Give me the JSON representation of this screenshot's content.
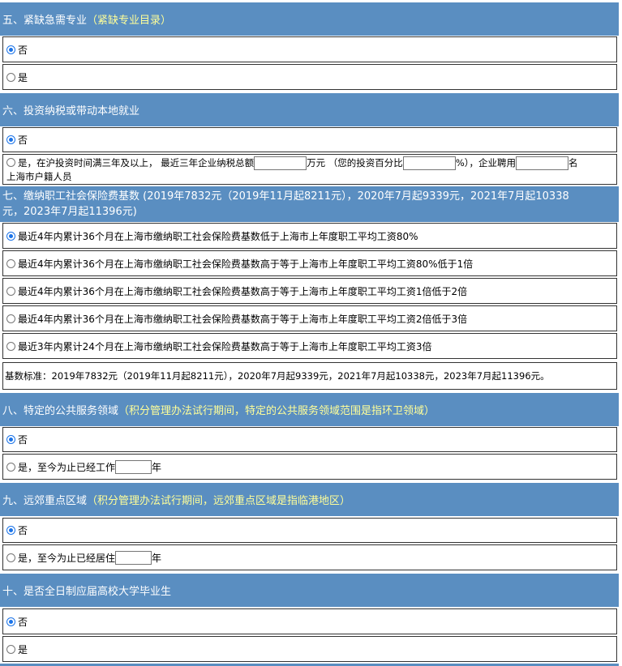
{
  "s5": {
    "title": "五、紧缺急需专业",
    "highlight": "（紧缺专业目录）",
    "opt_no": "否",
    "opt_yes": "是"
  },
  "s6": {
    "title": "六、投资纳税或带动本地就业",
    "opt_no": "否",
    "opt_yes_a": "是，在沪投资时间满三年及以上， 最近三年企业纳税总额",
    "opt_yes_b": "万元 （您的投资百分比",
    "opt_yes_c": "%），企业聘用",
    "opt_yes_d": "名",
    "opt_yes_e": "上海市户籍人员"
  },
  "s7": {
    "title_line1": "七、缴纳职工社会保险费基数 (2019年7832元（2019年11月起8211元），2020年7月起9339元，2021年7月起10338",
    "title_line2": "元，2023年7月起11396元)",
    "options": [
      "最近4年内累计36个月在上海市缴纳职工社会保险费基数低于上海市上年度职工平均工资80%",
      "最近4年内累计36个月在上海市缴纳职工社会保险费基数高于等于上海市上年度职工平均工资80%低于1倍",
      "最近4年内累计36个月在上海市缴纳职工社会保险费基数高于等于上海市上年度职工平均工资1倍低于2倍",
      "最近4年内累计36个月在上海市缴纳职工社会保险费基数高于等于上海市上年度职工平均工资2倍低于3倍",
      "最近3年内累计24个月在上海市缴纳职工社会保险费基数高于等于上海市上年度职工平均工资3倍"
    ],
    "note": "基数标准：2019年7832元（2019年11月起8211元），2020年7月起9339元，2021年7月起10338元，2023年7月起11396元。"
  },
  "s8": {
    "title": "八、特定的公共服务领域",
    "highlight": "（积分管理办法试行期间，特定的公共服务领域范围是指环卫领域）",
    "opt_no": "否",
    "opt_yes": "是，至今为止已经工作",
    "unit": "年"
  },
  "s9": {
    "title": "九、远郊重点区域 ",
    "highlight": "（积分管理办法试行期间，远郊重点区域是指临港地区）",
    "opt_no": "否",
    "opt_yes": "是，至今为止已经居住",
    "unit": "年"
  },
  "s10": {
    "title": "十、是否全日制应届高校大学毕业生",
    "opt_no": "否",
    "opt_yes": "是"
  },
  "colors": {
    "header_bg": "#5a8ec1",
    "highlight": "#ffff99",
    "radio_selected": "#1a73e8"
  }
}
